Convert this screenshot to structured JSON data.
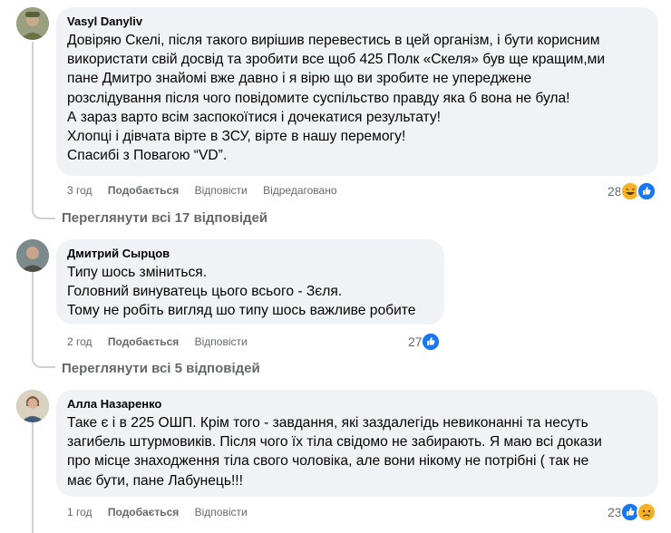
{
  "comments": [
    {
      "author": "Vasyl Danyliv",
      "lines": [
        "Довіряю Скелі, після такого вирішив перевестись в цей організм, і бути корисним",
        "використати свій досвід та зробити все щоб 425 Полк «Скеля» був ще кращим,ми",
        "пане Дмитро знайомі вже давно і я вірю що ви зробите не упереджене",
        "розслідування після чого повідомите суспільство правду яка б вона не була!",
        "А зараз варто всім заспокоїтися і дочекатися результату!",
        "Хлопці і дівчата вірте в ЗСУ, вірте в нашу перемогу!",
        "Спасибі з Повагою “VD”."
      ],
      "time": "3 год",
      "like": "Подобається",
      "reply": "Відповісти",
      "edited": "Відредаговано",
      "reaction_count": "28",
      "reaction_icons": [
        "haha-icon",
        "like-icon"
      ],
      "view_replies": "Переглянути всі 17 відповідей"
    },
    {
      "author": "Дмитрий Сырцов",
      "lines": [
        "Типу шось зміниться.",
        "Головний винуватець цього всього - Зєля.",
        "Тому не робіть вигляд шо типу шось важливе робите"
      ],
      "time": "2 год",
      "like": "Подобається",
      "reply": "Відповісти",
      "reaction_count": "27",
      "reaction_icons": [
        "like-icon"
      ],
      "view_replies": "Переглянути всі 5 відповідей"
    },
    {
      "author": "Алла Назаренко",
      "lines": [
        "Таке є і в 225 ОШП. Крім того - завдання, які заздалегідь невиконанні та несуть",
        "загибель штурмовиків. Після чого їх тіла свідомо не забирають. Я маю всі докази",
        "про місце знаходження тіла свого чоловіка, але вони нікому не потрібні ( так не",
        "має бути, пане Лабунець!!!"
      ],
      "time": "1 год",
      "like": "Подобається",
      "reply": "Відповісти",
      "reaction_count": "23",
      "reaction_icons": [
        "like-icon",
        "sad-icon"
      ]
    }
  ],
  "colors": {
    "bubble": "#f0f2f5",
    "meta": "#65676b",
    "like_blue": "#1877f2",
    "haha_yellow": "#f7b125",
    "thread_line": "#ced0d4"
  }
}
